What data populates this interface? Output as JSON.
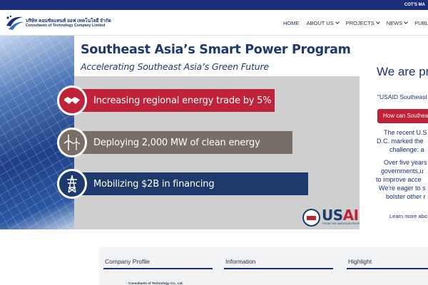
{
  "topbar": {
    "link_label": "COT'S MA"
  },
  "header": {
    "company_name_th": "บริษัท คอนซัลแทนท์ ออฟ เทคโนโลยี จำกัด",
    "company_name_en": "Consultants of Technology Company Limited",
    "nav": [
      {
        "label": "HOME",
        "active": true,
        "has_dropdown": false
      },
      {
        "label": "ABOUT US",
        "active": false,
        "has_dropdown": true
      },
      {
        "label": "PROJECTS",
        "active": false,
        "has_dropdown": true
      },
      {
        "label": "NEWS",
        "active": false,
        "has_dropdown": true
      },
      {
        "label": "PUBLICA",
        "active": false,
        "has_dropdown": false
      }
    ]
  },
  "hero": {
    "title": "Southeast Asia’s Smart Power Program",
    "subtitle": "Accelerating Southeast Asia’s Green Future",
    "stats": [
      {
        "text": "Increasing regional energy trade by 5%",
        "icon": "handshake-icon",
        "color": "#c0223a"
      },
      {
        "text": "Deploying 2,000 MW of clean energy",
        "icon": "wind-turbine-icon",
        "color": "#766e67"
      },
      {
        "text": "Mobilizing $2B in financing",
        "icon": "power-tower-icon",
        "color": "#1e3a6d"
      }
    ],
    "usaid": {
      "us": "US",
      "aid": "AID",
      "tagline": "FROM THE AMERICAN PEOPLE"
    }
  },
  "slide_text": {
    "heading": "We are pro",
    "quote": "\"USAID Southeast A",
    "button_label": "How can Southeas",
    "paragraph_1": [
      "The recent U.S",
      "D.C. marked the",
      "challenge: a"
    ],
    "paragraph_2": [
      "Over five years",
      "governments,u",
      "to improve acce",
      "We're eager to s",
      "bolster other r"
    ],
    "learn_more": "Learn more abo"
  },
  "info_section": {
    "columns": [
      {
        "title": "Company Profile"
      },
      {
        "title": "Information"
      },
      {
        "title": "Highlight"
      }
    ],
    "profile_text": "Consultants of Technology Co., Ltd."
  },
  "colors": {
    "brand_blue": "#1e2f7a",
    "accent_red": "#c0223a",
    "stat_grey": "#766e67",
    "navy": "#1e3a6d"
  }
}
